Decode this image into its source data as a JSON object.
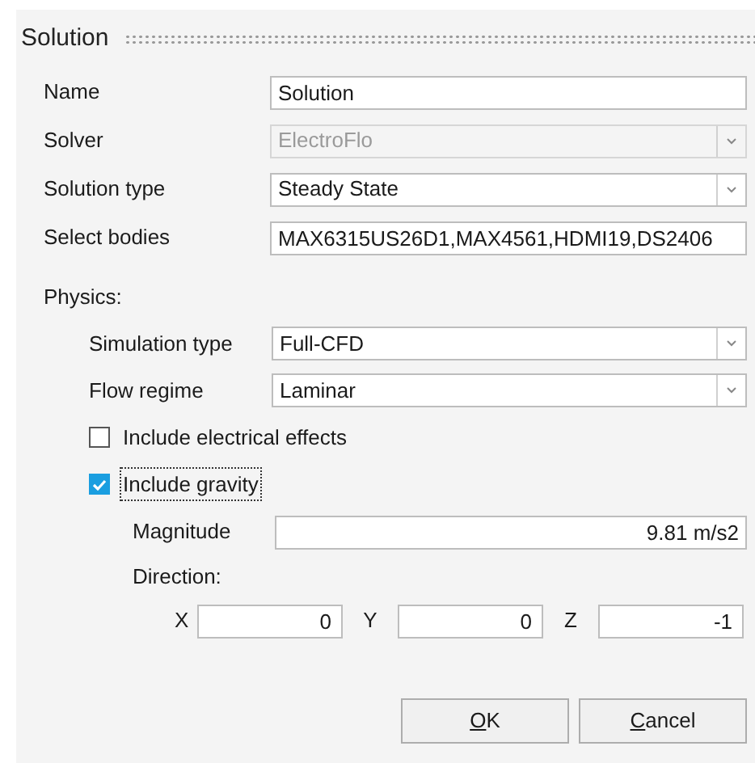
{
  "title": "Solution",
  "fields": [
    {
      "label": "Name",
      "kind": "text",
      "value": "Solution",
      "disabled": false
    },
    {
      "label": "Solver",
      "kind": "dropdown",
      "value": "ElectroFlo",
      "disabled": true
    },
    {
      "label": "Solution type",
      "kind": "dropdown",
      "value": "Steady State",
      "disabled": false
    },
    {
      "label": "Select bodies",
      "kind": "text",
      "value": "MAX6315US26D1,MAX4561,HDMI19,DS2406",
      "disabled": false
    }
  ],
  "physics": {
    "heading": "Physics:",
    "fields": [
      {
        "label": "Simulation type",
        "kind": "dropdown",
        "value": "Full-CFD",
        "disabled": false
      },
      {
        "label": "Flow regime",
        "kind": "dropdown",
        "value": "Laminar",
        "disabled": false
      }
    ],
    "checkboxes": [
      {
        "label": "Include electrical effects",
        "checked": false,
        "focused": false
      },
      {
        "label": "Include gravity",
        "checked": true,
        "focused": true
      }
    ],
    "gravity": {
      "magnitude_label": "Magnitude",
      "magnitude": "9.81 m/s2",
      "direction_heading": "Direction:",
      "components": [
        {
          "axis": "X",
          "value": "0"
        },
        {
          "axis": "Y",
          "value": "0"
        },
        {
          "axis": "Z",
          "value": "-1"
        }
      ]
    }
  },
  "buttons": [
    {
      "label_parts": [
        {
          "text": "O",
          "underlined": true
        },
        {
          "text": "K",
          "underlined": false
        }
      ]
    },
    {
      "label_parts": [
        {
          "text": "C",
          "underlined": true
        },
        {
          "text": "ancel",
          "underlined": false
        }
      ]
    }
  ]
}
